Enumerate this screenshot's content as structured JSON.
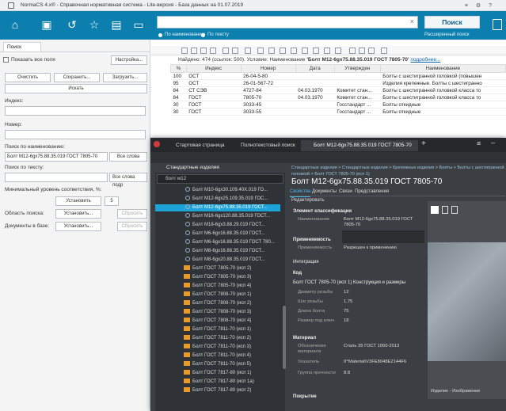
{
  "titlebar": {
    "title": "NormaCS 4.x® - Справочная нормативная система - Lite-версия - База данных на 01.07.2019"
  },
  "toolbar": {
    "search_value": "",
    "radio_by_name": "По наименованию",
    "radio_by_text": "По тексту",
    "search_button": "Поиск",
    "advanced_search": "Расширенный поиск"
  },
  "left": {
    "tab": "Поиск",
    "show_all": "Показать все поля",
    "settings": "Настройка...",
    "clear": "Очистить",
    "save": "Сохранить...",
    "load": "Загрузить...",
    "find": "Искать",
    "index_label": "Индекс:",
    "number_label": "Номер:",
    "name_search_label": "Поиск по наименованию:",
    "name_search_value": "Болт М12-6gx75.88.35.019 ГОСТ 7805-70",
    "all_words": "Все слова",
    "text_search_label": "Поиск по тексту:",
    "all_words_2": "Все слова подр",
    "min_level_label": "Минимальный уровень соответствия, %:",
    "install": "Установить",
    "min_value": "5",
    "area_label": "Область поиска:",
    "install2": "Установить...",
    "reset": "Сбросить",
    "docs_label": "Документы в базе:",
    "install3": "Установить...",
    "reset2": "Сбросить"
  },
  "results": {
    "found_prefix": "Найдено: 474 (ссылок: 500). Условие: Наименование ",
    "found_query": "'Болт М12-6gx75.88.35.019 ГОСТ 7805-70'",
    "found_link": "подробнее...",
    "columns": [
      "%",
      "Индекс",
      "Номер",
      "Дата",
      "Утвержден",
      "Наименование"
    ],
    "rows": [
      {
        "pct": "100",
        "index": "ОСТ",
        "number": "26-04-5-80",
        "date": "",
        "approved": "",
        "name": "Болты с шестигранной головкой (повышен"
      },
      {
        "pct": "95",
        "index": "ОСТ",
        "number": "26-01-567-72",
        "date": "",
        "approved": "",
        "name": "Изделия крепежные. Болты с шестигранно"
      },
      {
        "pct": "84",
        "index": "СТ СЭВ",
        "number": "4727-84",
        "date": "04.03.1970",
        "approved": "Комитет стан...",
        "name": "Болты с шестигранной головкой класса то"
      },
      {
        "pct": "84",
        "index": "ГОСТ",
        "number": "7805-70",
        "date": "04.03.1970",
        "approved": "Комитет стан...",
        "name": "Болты с шестигранной головкой класса то"
      },
      {
        "pct": "30",
        "index": "ГОСТ",
        "number": "3033-45",
        "date": "",
        "approved": "Госстандарт ...",
        "name": "Болты откидные"
      },
      {
        "pct": "30",
        "index": "ГОСТ",
        "number": "3033-55",
        "date": "",
        "approved": "Госстандарт ...",
        "name": "Болты откидные"
      }
    ]
  },
  "overlay": {
    "tabs": [
      "Стартовая страница",
      "Полнотекстовый поиск",
      "Болт М12-6gx75.88.35.019 ГОСТ 7805-70"
    ],
    "tree_header": "Стандартные изделия",
    "tree_search": "болт м12",
    "tree_items": [
      {
        "label": "Болт М10-6gx30.109.40Х.019 ГО...",
        "type": "part"
      },
      {
        "label": "Болт М12-6gx25.109.35.019 ГОС...",
        "type": "part"
      },
      {
        "label": "Болт М12-6gx75.88.35.019 ГОСТ...",
        "type": "part"
      },
      {
        "label": "Болт М16-6gx120.88.35.019 ГОСТ...",
        "type": "part"
      },
      {
        "label": "Болт М18-6gx3.88.29.019 ГОСТ...",
        "type": "part"
      },
      {
        "label": "Болт М6-6gx16.88.35.019 ГОСТ...",
        "type": "part"
      },
      {
        "label": "Болт М6-6gx16.88.35.019 ГОСТ 780...",
        "type": "part"
      },
      {
        "label": "Болт М8-6gx16.88.35.019 ГОСТ...",
        "type": "part"
      },
      {
        "label": "Болт М8-6gx20.88.35.019 ГОСТ...",
        "type": "part"
      },
      {
        "label": "Болт ГОСТ 7805-70 (исп 2)",
        "type": "folder"
      },
      {
        "label": "Болт ГОСТ 7805-70 (исп 3)",
        "type": "folder"
      },
      {
        "label": "Болт ГОСТ 7805-70 (исп 4)",
        "type": "folder"
      },
      {
        "label": "Болт ГОСТ 7808-70 (исп 1)",
        "type": "folder"
      },
      {
        "label": "Болт ГОСТ 7808-70 (исп 2)",
        "type": "folder"
      },
      {
        "label": "Болт ГОСТ 7808-70 (исп 3)",
        "type": "folder"
      },
      {
        "label": "Болт ГОСТ 7808-70 (исп 4)",
        "type": "folder"
      },
      {
        "label": "Болт ГОСТ 7811-70 (исп 1)",
        "type": "folder"
      },
      {
        "label": "Болт ГОСТ 7811-70 (исп 2)",
        "type": "folder"
      },
      {
        "label": "Болт ГОСТ 7811-70 (исп 3)",
        "type": "folder"
      },
      {
        "label": "Болт ГОСТ 7811-70 (исп 4)",
        "type": "folder"
      },
      {
        "label": "Болт ГОСТ 7811-70 (исп 5)",
        "type": "folder"
      },
      {
        "label": "Болт ГОСТ 7817-80 (исп 1)",
        "type": "folder"
      },
      {
        "label": "Болт ГОСТ 7817-80 (исп 1а)",
        "type": "folder"
      },
      {
        "label": "Болт ГОСТ 7817-80 (исп 2)",
        "type": "folder"
      }
    ],
    "breadcrumb": "Стандартные изделия > Стандартные изделия > Крепежные изделия > Болты > Болты с шестигранной головкой > Болт ГОСТ 7805-70 (исп 1)",
    "heading": "Болт М12-6gx75.88.35.019 ГОСТ 7805-70",
    "detail_tabs": [
      "Свойства",
      "Документы",
      "Связи",
      "Представления"
    ],
    "edit": "Редактировать",
    "sections": {
      "classification": "Элемент классификации",
      "applicability": "Применяемость",
      "integration": "Интеграция",
      "code": "Код",
      "design": "Болт ГОСТ 7805-70 (исп 1) Конструкция и размеры",
      "material": "Материал",
      "coating": "Покрытие"
    },
    "props": {
      "name_label": "Наименование",
      "name_value": "Болт М12-6gx75.88.35.019 ГОСТ 7805-70",
      "appl_label": "Применяемость",
      "appl_value": "Разрешен к применению",
      "thread_d_label": "Диаметр резьбы",
      "thread_d_value": "12",
      "pitch_label": "Шаг резьбы",
      "pitch_value": "1,75",
      "length_label": "Длина болта",
      "length_value": "75",
      "key_label": "Размер под ключ",
      "key_value": "18",
      "mat_label": "Обозначение материала",
      "mat_value": "Сталь 35 ГОСТ 1050-2013",
      "ptr_label": "Указатель",
      "ptr_value": "0^Material\\V3FE8048E2144F6",
      "group_label": "Группа прочности",
      "group_value": "8.8"
    },
    "graph_caption": "Изделие - Изображение"
  }
}
